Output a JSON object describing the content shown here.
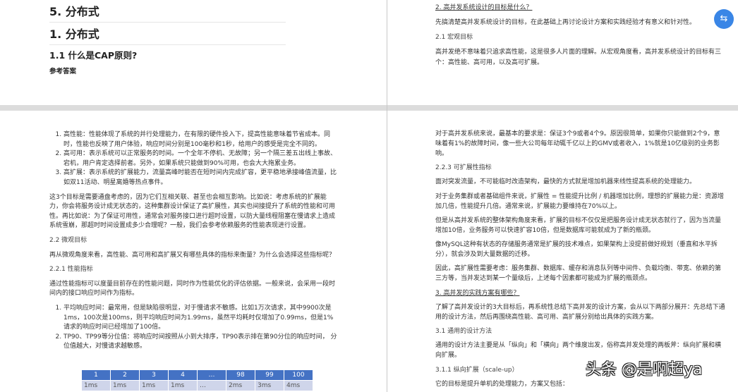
{
  "page1": {
    "h1a": "5. 分布式",
    "h1b": "1. 分布式",
    "h3": "1.1 什么是CAP原则?",
    "label": "参考答案"
  },
  "page2": {
    "heading": "2. 高并发系统设计的目标是什么？",
    "p1": "先搞清楚高并发系统设计的目标，在此基础上再讨论设计方案和实践经验才有意义和针对性。",
    "sub": "2.1 宏观目标",
    "p2": "高并发绝不意味着只追求高性能，这是很多人片面的理解。从宏观角度看，高并发系统设计的目标有三个：高性能、高可用，以及高可扩展。"
  },
  "page3": {
    "list1": [
      "高性能：性能体现了系统的并行处理能力，在有限的硬件投入下，提高性能意味着节省成本。同时，性能也反映了用户体验，响应时间分别是100毫秒和1秒，给用户的感受是完全不同的。",
      "高可用：表示系统可以正常服务的时间。一个全年不停机、无故障；另一个隔三差五出线上事故、宕机，用户肯定选择前者。另外，如果系统只能做到90%可用，也会大大拖累业务。",
      "高扩展：表示系统的扩展能力，流量高峰时能否在短时间内完成扩容，更平稳地承接峰值流量，比如双11活动、明星离婚等热点事件。"
    ],
    "p1": "这3个目标是需要通盘考虑的，因为它们互相关联、甚至也会相互影响。比如说：考虑系统的扩展能力，你会将服务设计成无状态的，这种集群设计保证了高扩展性，其实也间接提升了系统的性能和可用性。再比如说：为了保证可用性，通常会对服务接口进行超时设置，以防大量线程阻塞在慢请求上造成系统雪崩，那超时时间设置成多少合理呢？一般，我们会参考依赖服务的性能表现进行设置。",
    "sub1": "2.2 微观目标",
    "p2": "再从微观角度来看，高性能、高可用和高扩展又有哪些具体的指标来衡量？为什么会选择这些指标呢？",
    "sub2": "2.2.1 性能指标",
    "p3": "通过性能指标可以度量目前存在的性能问题，同时作为性能优化的评估依据。一般来说，会采用一段时间内的接口响应时间作为指标。",
    "list2": [
      "平均响应时间：最常用，但是缺陷很明显，对于慢请求不敏感。比如1万次请求，其中9900次是1ms，100次是100ms，则平均响应时间为1.99ms，虽然平均耗时仅增加了0.99ms，但是1%请求的响应时间已经增加了100倍。",
      "TP90、TP99等分位值：将响应时间按照从小到大排序，TP90表示排在第90分位的响应时间， 分位值越大，对慢请求越敏感。"
    ],
    "table": {
      "headers": [
        "1",
        "2",
        "3",
        "4",
        "…",
        "98",
        "99",
        "100"
      ],
      "row": [
        "1ms",
        "1ms",
        "1ms",
        "1ms",
        "…",
        "2ms",
        "3ms",
        "4ms"
      ]
    }
  },
  "page4": {
    "p1": "对于高并发系统来说，最基本的要求是：保证3个9或者4个9。原因很简单，如果你只能做到2个9，意味着有1%的故障时间，像一些大公司每年动辄千亿以上的GMV或者收入，1%就是10亿级别的业务影响。",
    "sub1": "2.2.3 可扩展性指标",
    "p2": "面对突发流量，不可能临时改造架构，最快的方式就是增加机器来线性提高系统的处理能力。",
    "p3": "对于业务集群或者基础组件来说，扩展性 = 性能提升比例 / 机器增加比例，理想的扩展能力是：资源增加几倍，性能提升几倍。通常来说，扩展能力要维持在70%以上。",
    "p4": "但是从高并发系统的整体架构角度来看，扩展的目标不仅仅是把服务设计成无状态就行了，因为当流量增加10倍，业务服务可以快速扩容10倍，但是数据库可能就成为了新的瓶颈。",
    "p5": "像MySQL这种有状态的存储服务通常是扩展的技术难点，如果架构上没提前做好规划（垂直和水平拆分），就会涉及到大量数据的迁移。",
    "p6": "因此，高扩展性需要考虑：服务集群、数据库、缓存和消息队列等中间件、负载均衡、带宽、依赖的第三方等，当并发达到某一个量级后，上述每个因素都可能成为扩展的瓶颈点。",
    "heading": "3. 高并发的实践方案有哪些？",
    "p7": "了解了高并发设计的3大目标后，再系统性总结下高并发的设计方案，会从以下两部分展开：先总结下通用的设计方法，然后再围绕高性能、高可用、高扩展分别给出具体的实践方案。",
    "sub2": "3.1 通用的设计方法",
    "p8": "通用的设计方法主要是从「纵向」和「横向」两个维度出发，俗称高并发处理的两板斧：纵向扩展和横向扩展。",
    "sub3": "3.1.1 纵向扩展（scale-up）",
    "p9": "它的目标是提升单机的处理能力，方案又包括："
  },
  "watermark": "头条 @是啊超ya",
  "fab_icon": "translate-icon"
}
